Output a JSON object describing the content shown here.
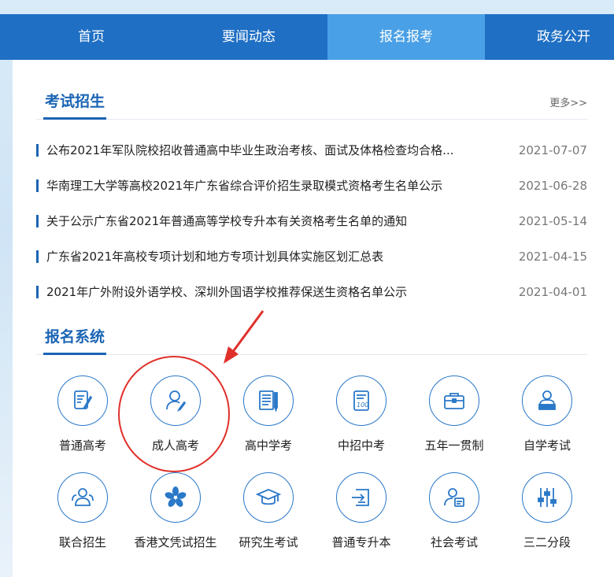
{
  "nav": {
    "items": [
      {
        "label": "首页"
      },
      {
        "label": "要闻动态"
      },
      {
        "label": "报名报考"
      },
      {
        "label": "政务公开"
      }
    ]
  },
  "exam_section": {
    "title": "考试招生",
    "more": "更多>>",
    "news": [
      {
        "title": "公布2021年军队院校招收普通高中毕业生政治考核、面试及体格检查均合格...",
        "date": "2021-07-07"
      },
      {
        "title": "华南理工大学等高校2021年广东省综合评价招生录取模式资格考生名单公示",
        "date": "2021-06-28"
      },
      {
        "title": "关于公示广东省2021年普通高等学校专升本有关资格考生名单的通知",
        "date": "2021-05-14"
      },
      {
        "title": "广东省2021年高校专项计划和地方专项计划具体实施区划汇总表",
        "date": "2021-04-15"
      },
      {
        "title": "2021年广外附设外语学校、深圳外国语学校推荐保送生资格名单公示",
        "date": "2021-04-01"
      }
    ]
  },
  "system_section": {
    "title": "报名系统",
    "tiles": [
      {
        "label": "普通高考",
        "icon": "document-pen-icon"
      },
      {
        "label": "成人高考",
        "icon": "person-edit-icon"
      },
      {
        "label": "高中学考",
        "icon": "notebook-pen-icon"
      },
      {
        "label": "中招中考",
        "icon": "score-sheet-icon"
      },
      {
        "label": "五年一贯制",
        "icon": "briefcase-icon"
      },
      {
        "label": "自学考试",
        "icon": "person-laptop-icon"
      },
      {
        "label": "联合招生",
        "icon": "group-icon"
      },
      {
        "label": "香港文凭试招生",
        "icon": "bauhinia-icon"
      },
      {
        "label": "研究生考试",
        "icon": "graduation-cap-icon"
      },
      {
        "label": "普通专升本",
        "icon": "transfer-icon"
      },
      {
        "label": "社会考试",
        "icon": "person-document-icon"
      },
      {
        "label": "三二分段",
        "icon": "sliders-icon"
      }
    ]
  },
  "colors": {
    "nav_bg": "#1f6fc4",
    "nav_active": "#4aa0e6",
    "accent": "#1a64b4",
    "annotation": "#e0302a"
  }
}
